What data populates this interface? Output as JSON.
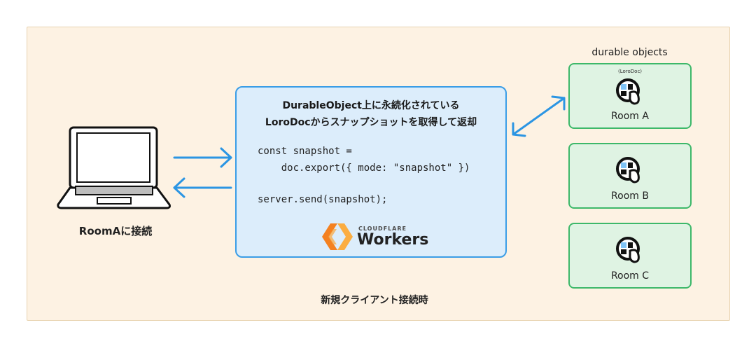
{
  "client": {
    "label": "RoomAに接続"
  },
  "worker": {
    "title_line1": "DurableObject上に永続化されている",
    "title_line2": "LoroDocからスナップショットを取得して返却",
    "code": [
      "const snapshot =",
      "    doc.export({ mode: \"snapshot\" })",
      "",
      "server.send(snapshot);"
    ],
    "logo_brand": "CLOUDFLARE",
    "logo_product": "Workers"
  },
  "durable_objects": {
    "heading": "durable objects",
    "rooms": [
      {
        "tag": "(LoroDoc)",
        "label": "Room A",
        "icon": "loro-icon"
      },
      {
        "tag": "",
        "label": "Room B",
        "icon": "loro-icon"
      },
      {
        "tag": "",
        "label": "Room C",
        "icon": "loro-icon"
      }
    ]
  },
  "footer": {
    "label": "新規クライアント接続時"
  },
  "colors": {
    "background": "#fdf2e3",
    "worker_fill": "#dcedfb",
    "worker_border": "#3a9de6",
    "arrow": "#2b95e3",
    "room_fill": "#dff3e3",
    "room_border": "#3db86a",
    "cloudflare_orange": "#f48120"
  }
}
